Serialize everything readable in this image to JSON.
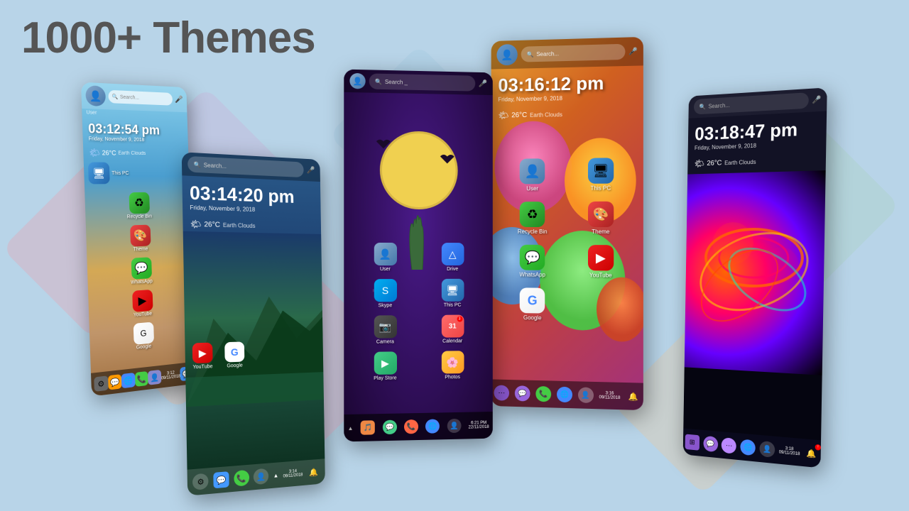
{
  "title": "1000+ Themes",
  "phone1": {
    "search_placeholder": "Search...",
    "user_label": "User",
    "pc_label": "This PC",
    "time": "03:12:54 pm",
    "date": "Friday, November 9, 2018",
    "weather": "26°C",
    "weather_desc": "Earth Clouds",
    "taskbar_time": "3:12",
    "taskbar_date": "09/11/2018"
  },
  "phone2": {
    "search_placeholder": "Search...",
    "time": "03:14:20 pm",
    "date": "Friday, November 9, 2018",
    "weather": "26°C",
    "weather_desc": "Earth Clouds",
    "youtube_label": "YouTube",
    "google_label": "Google",
    "taskbar_time": "3:14",
    "taskbar_date": "09/11/2018"
  },
  "phone3": {
    "search_placeholder": "Search _",
    "user_label": "User",
    "drive_label": "Drive",
    "this_pc_label": "This PC",
    "skype_label": "Skype",
    "camera_label": "Camera",
    "calendar_label": "Calendar",
    "playstore_label": "Play Store",
    "photos_label": "Photos",
    "taskbar_time": "6:21 PM",
    "taskbar_date": "22/11/2018"
  },
  "phone4": {
    "search_placeholder": "Search...",
    "user_label": "User",
    "this_pc_label": "This PC",
    "recycle_label": "Recycle Bin",
    "theme_label": "Theme",
    "whatsapp_label": "WhatsApp",
    "youtube_label": "YouTube",
    "google_label": "Google",
    "time": "03:16:12 pm",
    "date": "Friday, November 9, 2018",
    "weather": "26°C",
    "weather_desc": "Earth Clouds",
    "taskbar_time": "3:16",
    "taskbar_date": "09/11/2018"
  },
  "phone5": {
    "search_placeholder": "Search...",
    "time": "03:18:47 pm",
    "date": "Friday, November 9, 2018",
    "weather": "26°C",
    "weather_desc": "Earth Clouds",
    "taskbar_time": "3:18",
    "taskbar_date": "09/11/2018"
  }
}
